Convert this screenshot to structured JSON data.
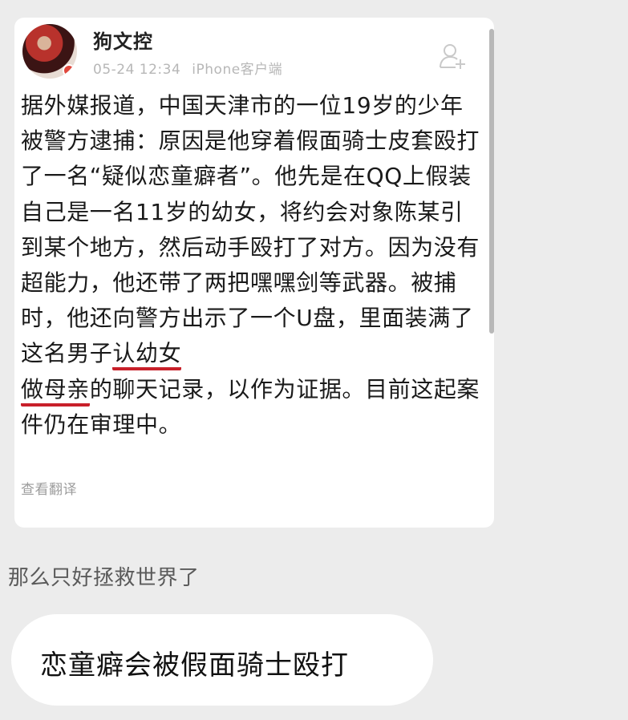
{
  "post": {
    "username": "狗文控",
    "timestamp": "05-24 12:34",
    "source": "iPhone客户端",
    "follow_icon": "add-user-icon",
    "body": {
      "before_highlight": "据外媒报道，中国天津市的一位19岁的少年被警方逮捕：原因是他穿着假面骑士皮套殴打了一名“疑似恋童癖者”。他先是在QQ上假装自己是一名11岁的幼女，将约会对象陈某引到某个地方，然后动手殴打了对方。因为没有超能力，他还带了两把嘿嘿剑等武器。被捕时，他还向警方出示了一个U盘，里面装满了这名男子",
      "highlight_1": "认幼女",
      "highlight_2": "做母亲",
      "after_highlight": "的聊天记录，以作为证据。目前这起案件仍在审理中。"
    },
    "translate_link": "查看翻译",
    "highlight_color": "#c8202a"
  },
  "caption": "那么只好拯救世界了",
  "bubble_text": "恋童癖会被假面骑士殴打"
}
